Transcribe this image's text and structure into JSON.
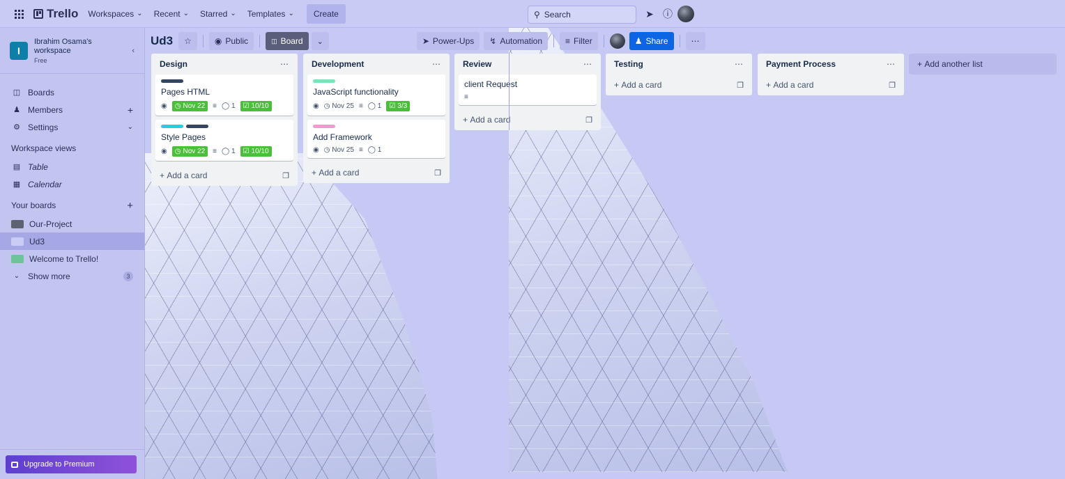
{
  "nav": {
    "brand": "Trello",
    "workspaces": "Workspaces",
    "recent": "Recent",
    "starred": "Starred",
    "templates": "Templates",
    "create": "Create",
    "search_placeholder": "Search"
  },
  "sidebar": {
    "workspace_name": "Ibrahim Osama's workspace",
    "workspace_initial": "I",
    "plan": "Free",
    "items": [
      {
        "label": "Boards"
      },
      {
        "label": "Members"
      },
      {
        "label": "Settings"
      }
    ],
    "views_heading": "Workspace views",
    "views": [
      {
        "label": "Table"
      },
      {
        "label": "Calendar"
      }
    ],
    "your_boards_heading": "Your boards",
    "boards": [
      {
        "label": "Our-Project",
        "color": "#5d6373"
      },
      {
        "label": "Ud3",
        "color": "#c9ccf4"
      },
      {
        "label": "Welcome to Trello!",
        "color": "#6fc39a"
      }
    ],
    "show_more": "Show more",
    "show_more_count": "3",
    "upgrade": "Upgrade to Premium"
  },
  "board": {
    "title": "Ud3",
    "visibility": "Public",
    "view": "Board",
    "power_ups": "Power-Ups",
    "automation": "Automation",
    "filter": "Filter",
    "share": "Share"
  },
  "lists": [
    {
      "title": "Design",
      "cards": [
        {
          "title": "Pages HTML",
          "labels": [
            "#344563"
          ],
          "due": "Nov 22",
          "comments": "1",
          "checklist": "10/10"
        },
        {
          "title": "Style Pages",
          "labels": [
            "#29cce5",
            "#344563"
          ],
          "due": "Nov 22",
          "comments": "1",
          "checklist": "10/10"
        }
      ],
      "add_card": "Add a card"
    },
    {
      "title": "Development",
      "cards": [
        {
          "title": "JavaScript functionality",
          "labels": [
            "#7ee2b8"
          ],
          "due": "Nov 25",
          "comments": "1",
          "checklist": "3/3"
        },
        {
          "title": "Add Framework",
          "labels": [
            "#f797d2"
          ],
          "due": "Nov 25",
          "comments": "1"
        }
      ],
      "add_card": "Add a card"
    },
    {
      "title": "Review",
      "cards": [
        {
          "title": "client Request"
        }
      ],
      "add_card": "Add a card"
    },
    {
      "title": "Testing",
      "cards": [],
      "add_card": "Add a card"
    },
    {
      "title": "Payment Process",
      "cards": [],
      "add_card": "Add a card"
    }
  ],
  "add_list": "Add another list",
  "colors": {
    "accent": "#0c66e4",
    "complete_badge": "#4bbf3b",
    "premium": "#7a4ad6"
  }
}
